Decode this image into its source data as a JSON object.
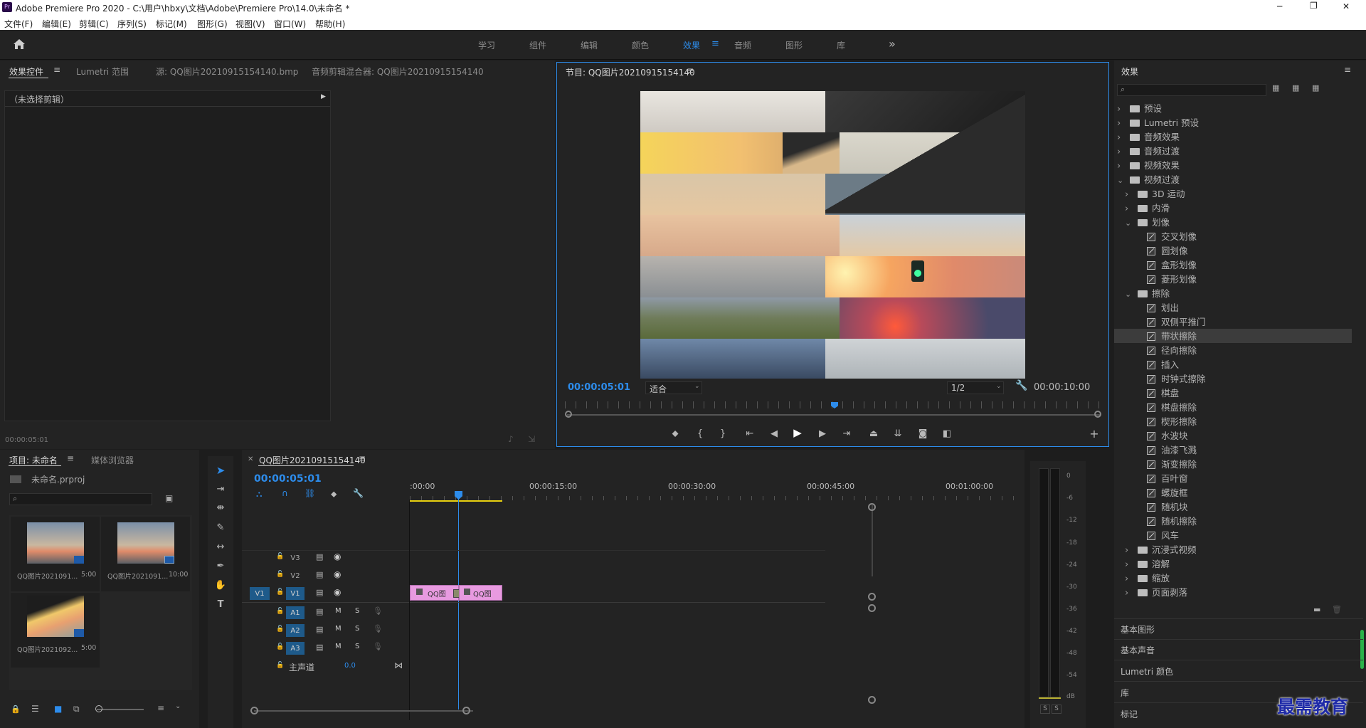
{
  "window": {
    "title": "Adobe Premiere Pro 2020 - C:\\用户\\hbxy\\文档\\Adobe\\Premiere Pro\\14.0\\未命名 *",
    "controls": [
      "─",
      "❐",
      "✕"
    ]
  },
  "menu": [
    "文件(F)",
    "编辑(E)",
    "剪辑(C)",
    "序列(S)",
    "标记(M)",
    "图形(G)",
    "视图(V)",
    "窗口(W)",
    "帮助(H)"
  ],
  "workspaces": {
    "tabs": [
      "学习",
      "组件",
      "编辑",
      "颜色",
      "效果",
      "音频",
      "图形",
      "库"
    ],
    "active_index": 4,
    "more": "»"
  },
  "source_panel": {
    "tabs": [
      "效果控件",
      "Lumetri 范围",
      "源: QQ图片20210915154140.bmp",
      "音频剪辑混合器: QQ图片20210915154140"
    ],
    "no_clip": "（未选择剪辑）",
    "timecode": "00:00:05:01"
  },
  "program_monitor": {
    "title": "节目: QQ图片20210915154140",
    "timecode": "00:00:05:01",
    "fit": "适合",
    "resolution": "1/2",
    "duration": "00:00:10:00",
    "playhead_fraction": 0.5
  },
  "project_panel": {
    "tabs": [
      "项目: 未命名",
      "媒体浏览器"
    ],
    "project_file": "未命名.prproj",
    "items": [
      {
        "name": "QQ图片2021091...",
        "duration": "5:00"
      },
      {
        "name": "QQ图片2021091...",
        "duration": "10:00"
      },
      {
        "name": "QQ图片2021092...",
        "duration": "5:00"
      }
    ]
  },
  "timeline": {
    "title": "QQ图片20210915154140",
    "timecode": "00:00:05:01",
    "ruler": [
      ":00:00",
      "00:00:15:00",
      "00:00:30:00",
      "00:00:45:00",
      "00:01:00:00"
    ],
    "video_tracks": [
      "V3",
      "V2",
      "V1"
    ],
    "audio_tracks": [
      "A1",
      "A2",
      "A3"
    ],
    "source_patch": "V1",
    "master_label": "主声道",
    "master_value": "0.0",
    "clip_labels": [
      "QQ图",
      "QQ图"
    ]
  },
  "meter": {
    "scale": [
      "0",
      "-6",
      "-12",
      "-18",
      "-24",
      "-30",
      "-36",
      "-42",
      "-48",
      "-54",
      "dB"
    ],
    "solo": [
      "S",
      "S"
    ]
  },
  "effects_panel": {
    "title": "效果",
    "tree": [
      {
        "label": "预设",
        "type": "folder",
        "level": 0,
        "open": false
      },
      {
        "label": "Lumetri 预设",
        "type": "folder",
        "level": 0,
        "open": false
      },
      {
        "label": "音频效果",
        "type": "folder",
        "level": 0,
        "open": false
      },
      {
        "label": "音频过渡",
        "type": "folder",
        "level": 0,
        "open": false
      },
      {
        "label": "视频效果",
        "type": "folder",
        "level": 0,
        "open": false
      },
      {
        "label": "视频过渡",
        "type": "folder",
        "level": 0,
        "open": true
      },
      {
        "label": "3D 运动",
        "type": "folder",
        "level": 1,
        "open": false
      },
      {
        "label": "内滑",
        "type": "folder",
        "level": 1,
        "open": false
      },
      {
        "label": "划像",
        "type": "folder",
        "level": 1,
        "open": true
      },
      {
        "label": "交叉划像",
        "type": "fx",
        "level": 2
      },
      {
        "label": "圆划像",
        "type": "fx",
        "level": 2
      },
      {
        "label": "盒形划像",
        "type": "fx",
        "level": 2
      },
      {
        "label": "菱形划像",
        "type": "fx",
        "level": 2
      },
      {
        "label": "擦除",
        "type": "folder",
        "level": 1,
        "open": true
      },
      {
        "label": "划出",
        "type": "fx",
        "level": 2
      },
      {
        "label": "双侧平推门",
        "type": "fx",
        "level": 2
      },
      {
        "label": "带状擦除",
        "type": "fx",
        "level": 2,
        "selected": true
      },
      {
        "label": "径向擦除",
        "type": "fx",
        "level": 2
      },
      {
        "label": "插入",
        "type": "fx",
        "level": 2
      },
      {
        "label": "时钟式擦除",
        "type": "fx",
        "level": 2
      },
      {
        "label": "棋盘",
        "type": "fx",
        "level": 2
      },
      {
        "label": "棋盘擦除",
        "type": "fx",
        "level": 2
      },
      {
        "label": "楔形擦除",
        "type": "fx",
        "level": 2
      },
      {
        "label": "水波块",
        "type": "fx",
        "level": 2
      },
      {
        "label": "油漆飞溅",
        "type": "fx",
        "level": 2
      },
      {
        "label": "渐变擦除",
        "type": "fx",
        "level": 2
      },
      {
        "label": "百叶窗",
        "type": "fx",
        "level": 2
      },
      {
        "label": "螺旋框",
        "type": "fx",
        "level": 2
      },
      {
        "label": "随机块",
        "type": "fx",
        "level": 2
      },
      {
        "label": "随机擦除",
        "type": "fx",
        "level": 2
      },
      {
        "label": "风车",
        "type": "fx",
        "level": 2
      },
      {
        "label": "沉浸式视频",
        "type": "folder",
        "level": 1,
        "open": false
      },
      {
        "label": "溶解",
        "type": "folder",
        "level": 1,
        "open": false
      },
      {
        "label": "缩放",
        "type": "folder",
        "level": 1,
        "open": false
      },
      {
        "label": "页面剥落",
        "type": "folder",
        "level": 1,
        "open": false
      }
    ],
    "sections": [
      "基本图形",
      "基本声音",
      "Lumetri 颜色",
      "库",
      "标记"
    ]
  },
  "watermark": "最需教育"
}
